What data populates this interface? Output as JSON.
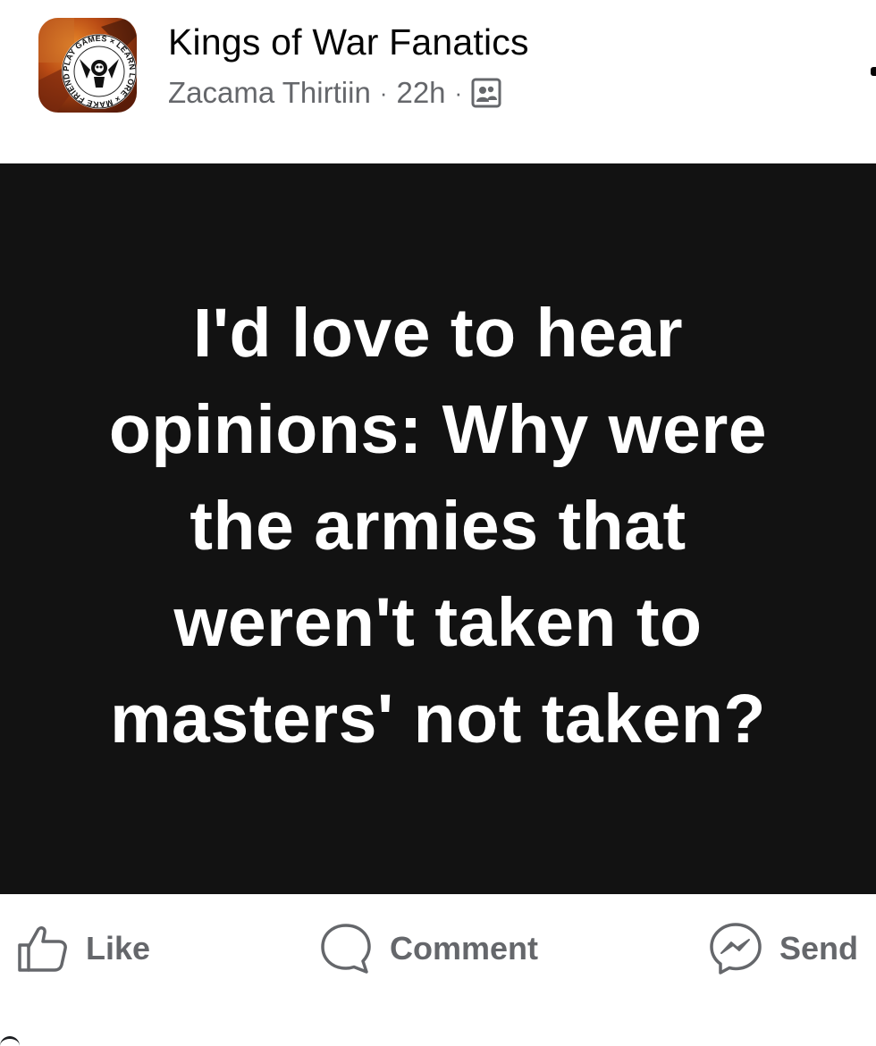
{
  "header": {
    "group_name": "Kings of War Fanatics",
    "author": "Zacama Thirtiin",
    "time": "22h",
    "separator": "·",
    "audience_icon": "group-members-icon",
    "avatar": {
      "icon": "group-logo",
      "ring_text": "PLAY GAMES × LEARN LORE × MAKE FRIENDS ×"
    }
  },
  "post": {
    "background": "#121212",
    "text_color": "#ffffff",
    "lines": [
      "I'd love to hear",
      "opinions: Why were",
      "the armies that",
      "weren't taken to",
      "masters' not taken?"
    ]
  },
  "actions": {
    "like": {
      "label": "Like",
      "icon": "thumbs-up-icon"
    },
    "comment": {
      "label": "Comment",
      "icon": "comment-bubble-icon"
    },
    "send": {
      "label": "Send",
      "icon": "messenger-icon"
    }
  },
  "colors": {
    "primary_text": "#050505",
    "secondary_text": "#65676b"
  }
}
